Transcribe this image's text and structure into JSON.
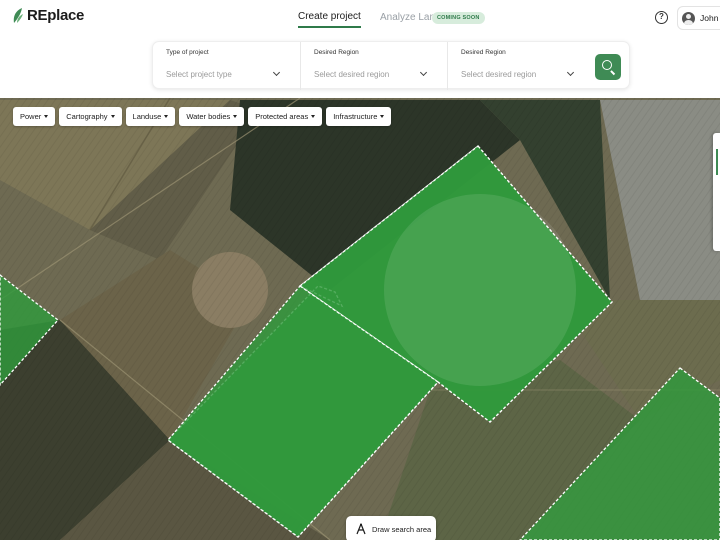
{
  "app": {
    "name": "REplace"
  },
  "nav": {
    "tabs": [
      {
        "label": "Create project",
        "active": true
      },
      {
        "label": "Analyze Land",
        "active": false,
        "badge": "COMING SOON"
      }
    ]
  },
  "user": {
    "name": "John"
  },
  "search": {
    "fields": [
      {
        "label": "Type of project",
        "placeholder": "Select project type"
      },
      {
        "label": "Desired Region",
        "placeholder": "Select desired region"
      },
      {
        "label": "Desired Region",
        "placeholder": "Select desired region"
      }
    ],
    "button_icon": "search-icon"
  },
  "layers": [
    {
      "label": "Power"
    },
    {
      "label": "Cartography"
    },
    {
      "label": "Landuse"
    },
    {
      "label": "Water bodies"
    },
    {
      "label": "Protected areas"
    },
    {
      "label": "Infrastructure"
    }
  ],
  "map": {
    "draw_button": "Draw search area",
    "highlight_color": "#2f9a3c"
  },
  "colors": {
    "accent": "#3f8b55",
    "badge_bg": "#d7ecdc"
  }
}
